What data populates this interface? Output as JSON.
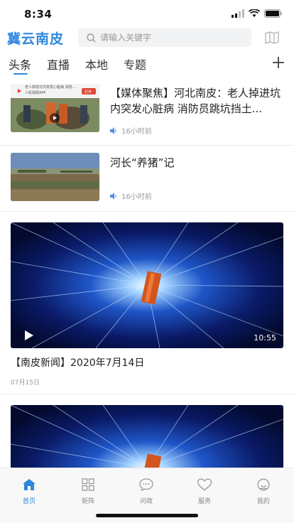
{
  "status_bar": {
    "time": "8:34"
  },
  "header": {
    "logo": "冀云南皮",
    "search": {
      "placeholder": "请输入关键字",
      "value": ""
    }
  },
  "tabs": [
    {
      "label": "头条",
      "active": true
    },
    {
      "label": "直播",
      "active": false
    },
    {
      "label": "本地",
      "active": false
    },
    {
      "label": "专题",
      "active": false
    }
  ],
  "feed": {
    "items": [
      {
        "title": "【媒体聚焦】河北南皮：老人掉进坑内突发心脏病 消防员跳坑挡土...",
        "time": "16小时前",
        "thumb_banner": "老人摔进坑内突发心脏病 消防...",
        "thumb_app": "人民视频APP",
        "thumb_open": "打开"
      },
      {
        "title": "河长“养猪”记",
        "time": "16小时前"
      },
      {
        "title": "【南皮新闻】2020年7月14日",
        "date": "07月15日",
        "duration": "10:55"
      }
    ]
  },
  "bottom_nav": [
    {
      "label": "首页",
      "icon": "home-icon",
      "active": true
    },
    {
      "label": "矩阵",
      "icon": "grid-icon",
      "active": false
    },
    {
      "label": "问政",
      "icon": "chat-icon",
      "active": false
    },
    {
      "label": "服务",
      "icon": "heart-icon",
      "active": false
    },
    {
      "label": "我的",
      "icon": "user-icon",
      "active": false
    }
  ],
  "colors": {
    "accent": "#2e86de",
    "text": "#222222",
    "muted": "#999999"
  }
}
